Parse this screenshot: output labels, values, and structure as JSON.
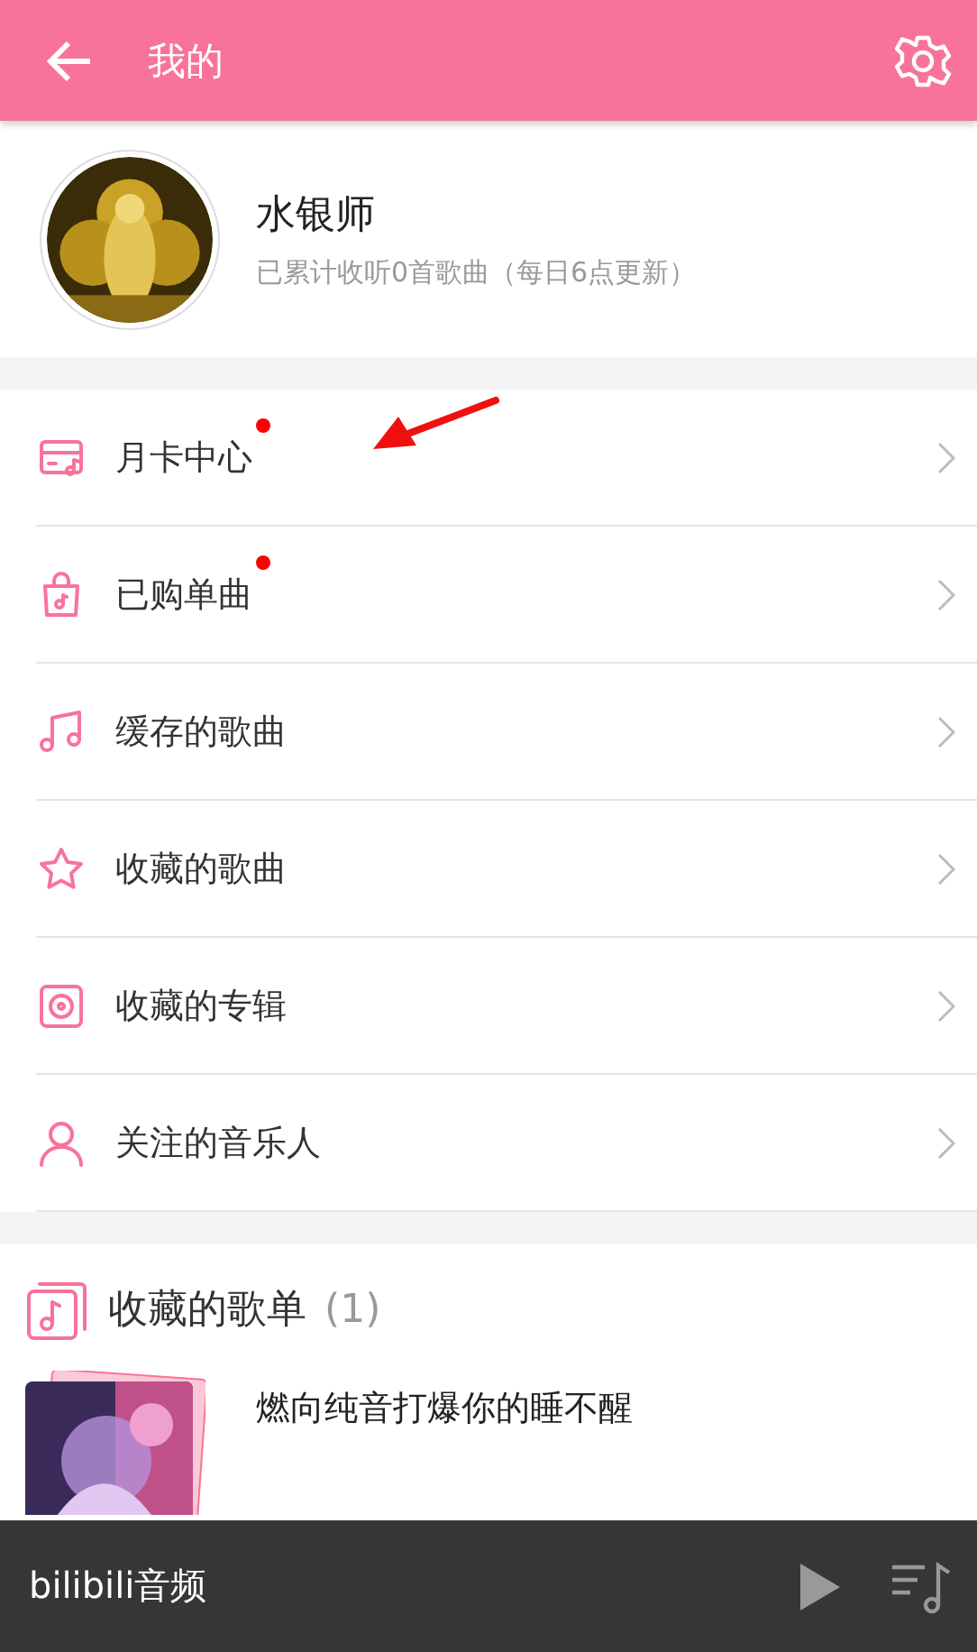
{
  "header": {
    "title": "我的"
  },
  "profile": {
    "name": "水银师",
    "subtitle": "已累计收听0首歌曲（每日6点更新）"
  },
  "menu": [
    {
      "kind": "card",
      "label": "月卡中心",
      "badge": true
    },
    {
      "kind": "bag",
      "label": "已购单曲",
      "badge": true
    },
    {
      "kind": "note",
      "label": "缓存的歌曲",
      "badge": false
    },
    {
      "kind": "star",
      "label": "收藏的歌曲",
      "badge": false
    },
    {
      "kind": "disc",
      "label": "收藏的专辑",
      "badge": false
    },
    {
      "kind": "person",
      "label": "关注的音乐人",
      "badge": false
    }
  ],
  "playlists": {
    "title": "收藏的歌单",
    "count": "(1)",
    "items": [
      {
        "title": "燃向纯音打爆你的睡不醒"
      }
    ]
  },
  "player": {
    "title": "bilibili音频"
  }
}
